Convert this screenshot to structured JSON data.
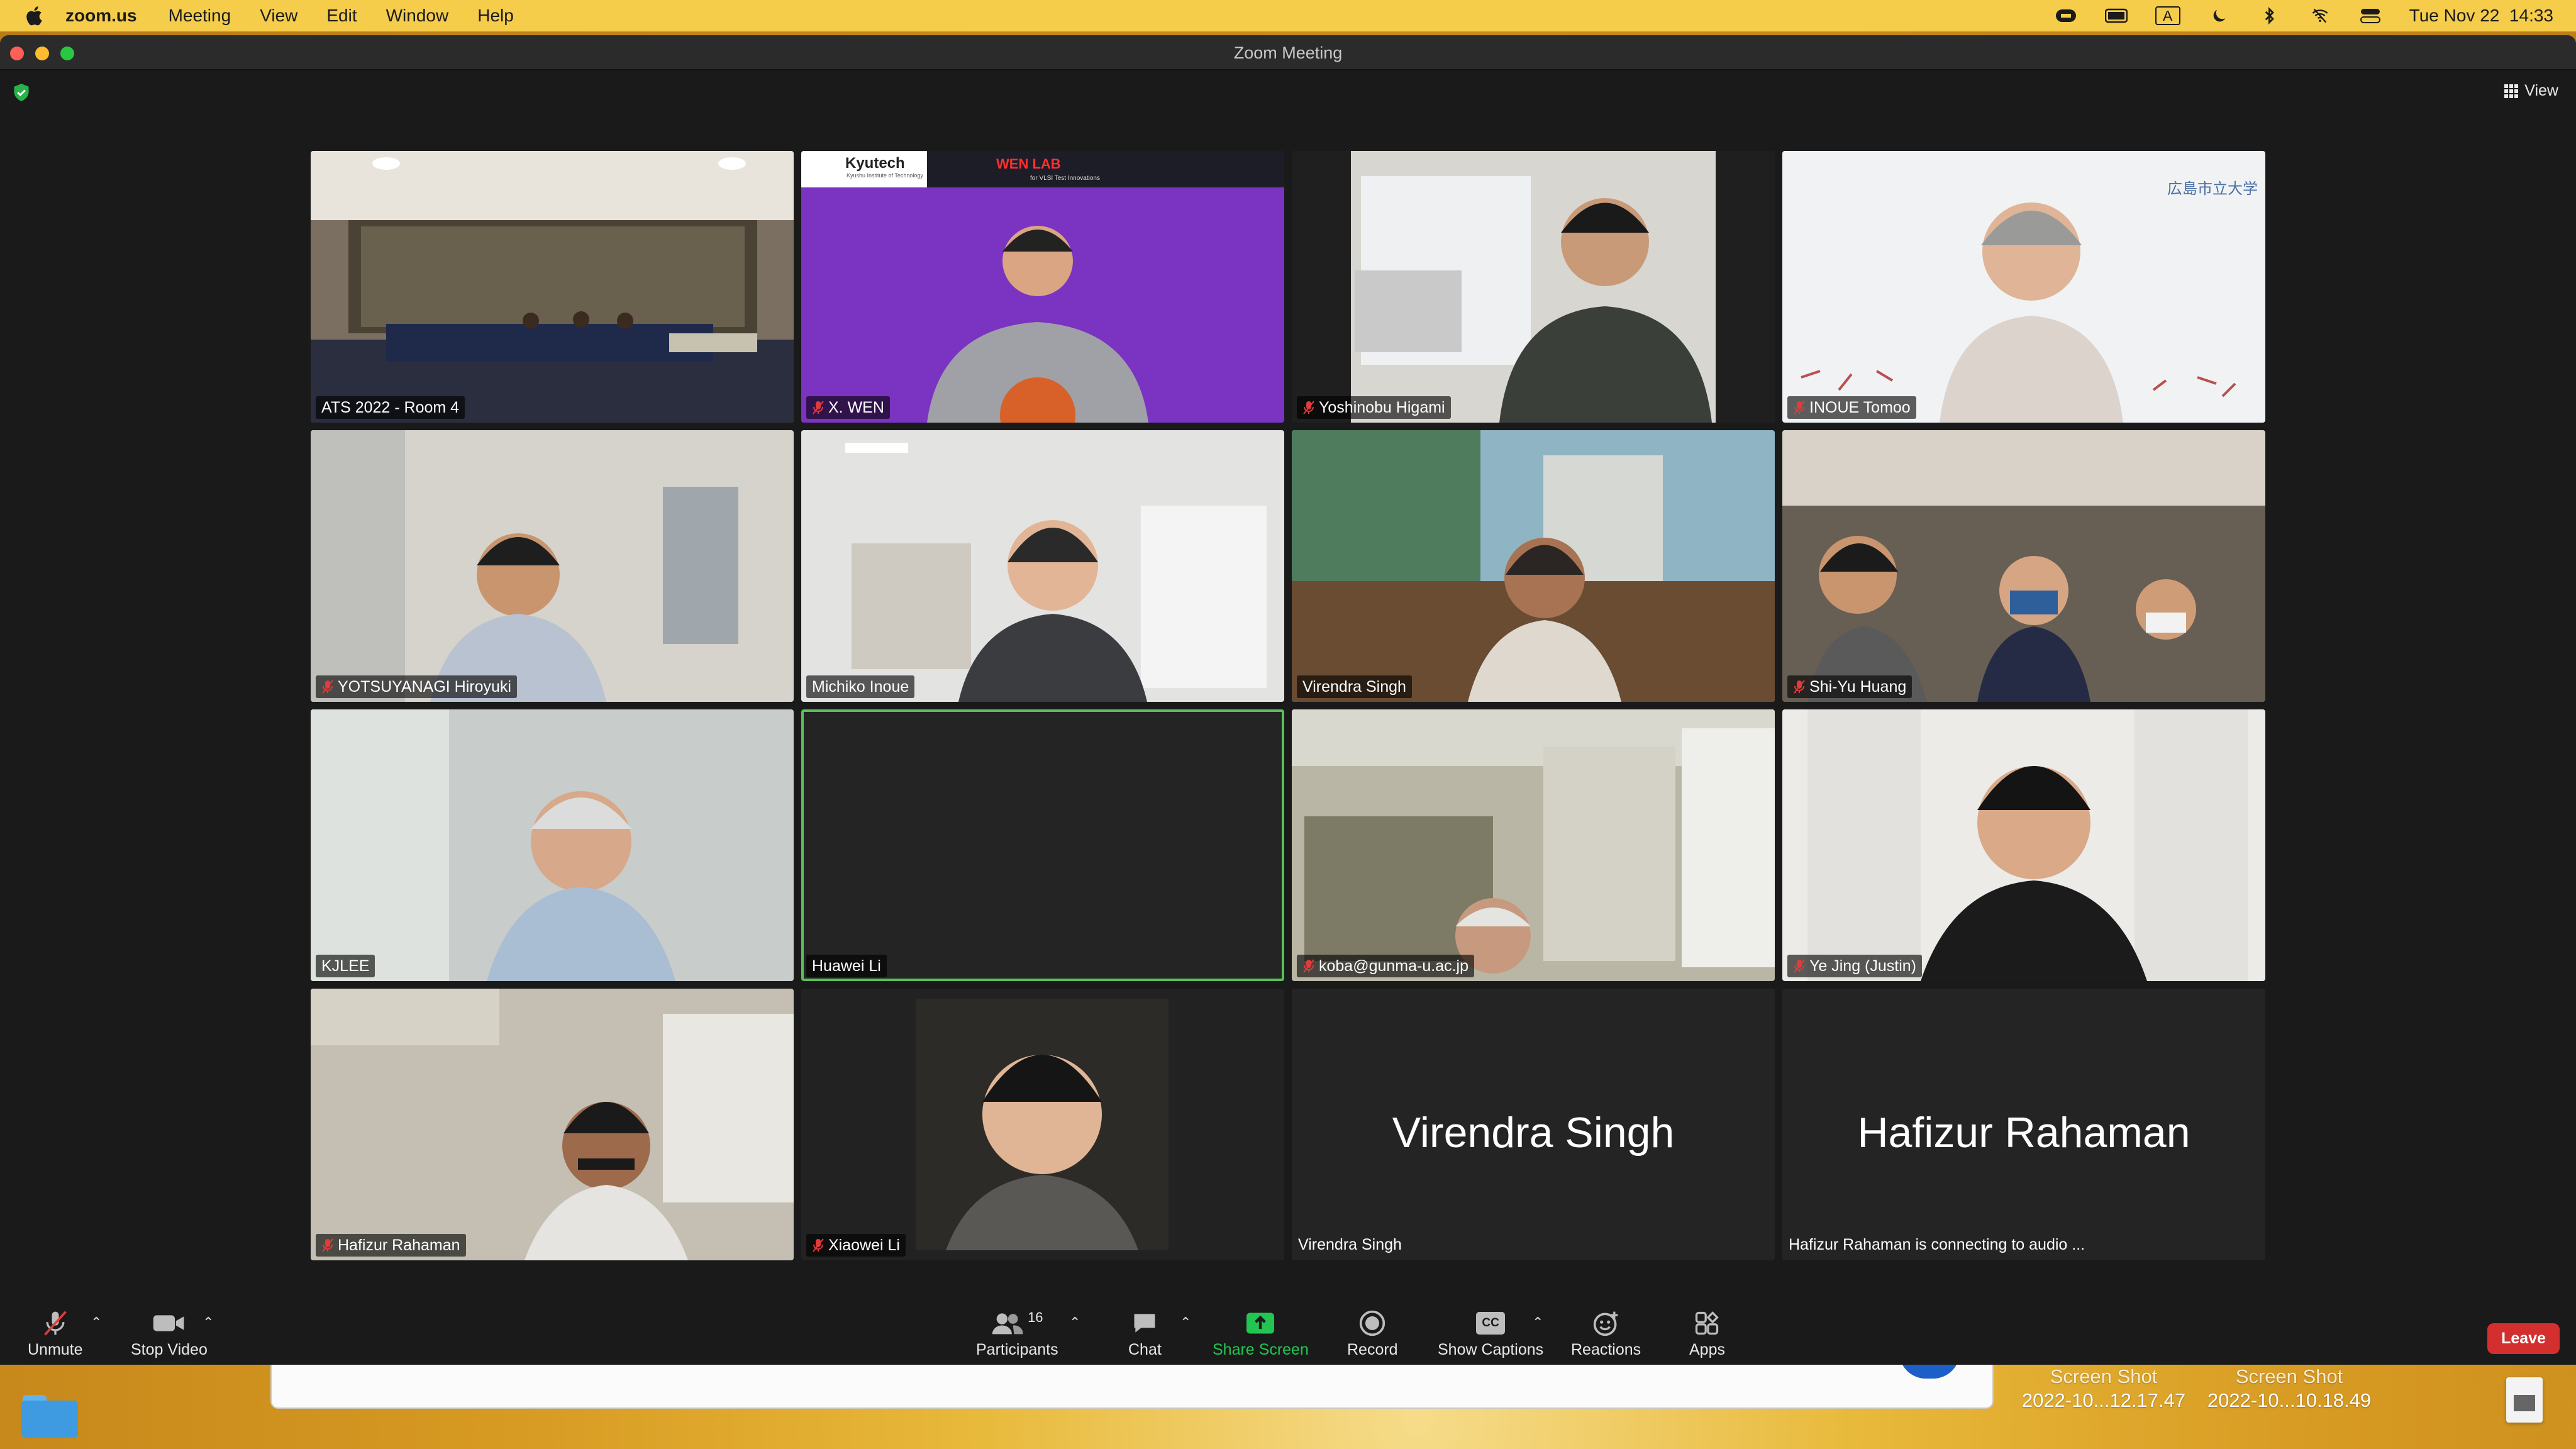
{
  "menubar": {
    "app": "zoom.us",
    "items": [
      "Meeting",
      "View",
      "Edit",
      "Window",
      "Help"
    ],
    "clock": "Tue Nov 22  14:33",
    "input_source": "A"
  },
  "window": {
    "title": "Zoom Meeting",
    "view_label": "View"
  },
  "participants": [
    {
      "name": "ATS 2022 - Room 4",
      "muted": false
    },
    {
      "name": "X. WEN",
      "muted": true,
      "backdrop_brand": "Kyutech",
      "backdrop_sub": "Kyushu Institute of Technology",
      "backdrop_lab": "WEN LAB",
      "backdrop_tag": "for VLSI Test Innovations"
    },
    {
      "name": "Yoshinobu Higami",
      "muted": true
    },
    {
      "name": "INOUE Tomoo",
      "muted": true,
      "backdrop_logo": "広島市立大学"
    },
    {
      "name": "YOTSUYANAGI Hiroyuki",
      "muted": true
    },
    {
      "name": "Michiko Inoue",
      "muted": false
    },
    {
      "name": "Virendra Singh",
      "muted": false
    },
    {
      "name": "Shi-Yu Huang",
      "muted": true
    },
    {
      "name": "KJLEE",
      "muted": false
    },
    {
      "name": "Huawei Li",
      "muted": false,
      "video": false,
      "active_speaker": true
    },
    {
      "name": "koba@gunma-u.ac.jp",
      "muted": true
    },
    {
      "name": "Ye Jing (Justin)",
      "muted": true
    },
    {
      "name": "Hafizur Rahaman",
      "muted": true
    },
    {
      "name": "Xiaowei Li",
      "muted": true
    },
    {
      "name": "Virendra Singh",
      "muted": false,
      "video": false,
      "display": "Virendra Singh"
    },
    {
      "name": "Hafizur Rahaman is connecting to audio  ...",
      "muted": false,
      "video": false,
      "display": "Hafizur Rahaman"
    }
  ],
  "toolbar": {
    "unmute": "Unmute",
    "stop_video": "Stop Video",
    "participants": "Participants",
    "participant_count": "16",
    "chat": "Chat",
    "share": "Share Screen",
    "record": "Record",
    "captions": "Show Captions",
    "reactions": "Reactions",
    "apps": "Apps",
    "leave": "Leave",
    "captions_badge": "CC"
  },
  "desktop": {
    "shots": [
      {
        "title": "Screen Shot",
        "date": "2022-10...12.17.47"
      },
      {
        "title": "Screen Shot",
        "date": "2022-10...10.18.49"
      }
    ]
  },
  "colors": {
    "menubar": "#f5cd4b",
    "share_green": "#23c552",
    "leave_red": "#d32f2f",
    "active_border": "#5ac05a",
    "mute_red": "#e23b3b"
  }
}
